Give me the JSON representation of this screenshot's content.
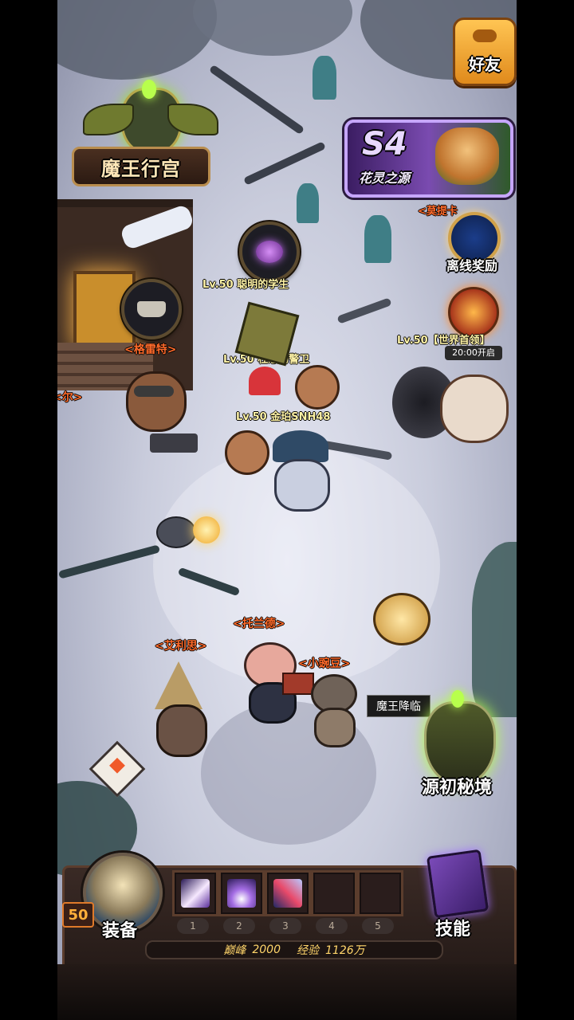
{
  "top_right": {
    "friends_label": "好友"
  },
  "event_banner": {
    "season": "S4",
    "subtitle": "花灵之源"
  },
  "palace": {
    "label": "魔王行宫"
  },
  "offline_reward": {
    "label": "离线奖励"
  },
  "world_boss": {
    "timer": "20:00开启",
    "name_partial": "<莫提卡"
  },
  "player_names": [
    "Lv.50 聪明的学生",
    "Lv.50 杜恐的警卫",
    "Lv.50 金珀SNH48",
    "Lv.50【世界首领】"
  ],
  "npc_names": {
    "blacksmith": "<格雷特>",
    "left_edge": "<尔>",
    "elise": "<艾利思>",
    "toland": "<托兰德>",
    "xiaowan": "<小豌豆>"
  },
  "demon_descend": {
    "label": "魔王降临"
  },
  "primal_realm": {
    "label": "源初秘境"
  },
  "hud": {
    "level": "50",
    "equip_label": "装备",
    "skill_label": "技能",
    "slot_numbers": [
      "1",
      "2",
      "3",
      "4",
      "5"
    ],
    "peak_label": "巅峰",
    "peak_value": "2000",
    "exp_label": "经验",
    "exp_value": "1126万"
  },
  "colors": {
    "npc_name": "#ff6a2a",
    "player_name": "#fff3a6",
    "friends_button": "#f0a12a",
    "hud_frame": "#5b3d2d"
  }
}
